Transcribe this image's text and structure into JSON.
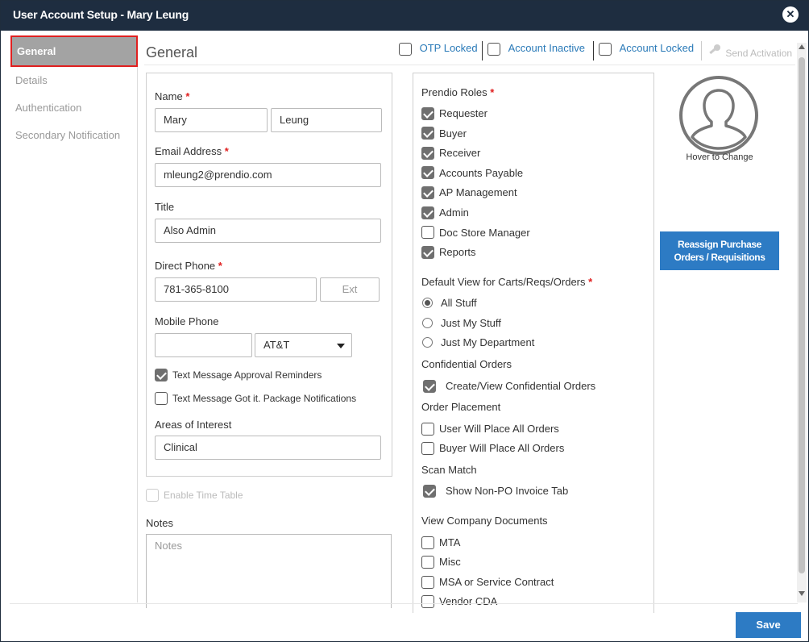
{
  "window": {
    "title": "User Account Setup - Mary Leung"
  },
  "nav": {
    "items": [
      {
        "label": "General"
      },
      {
        "label": "Details"
      },
      {
        "label": "Authentication"
      },
      {
        "label": "Secondary Notification"
      }
    ]
  },
  "header": {
    "title": "General",
    "otp_locked": "OTP Locked",
    "account_inactive": "Account Inactive",
    "account_locked": "Account Locked",
    "send_activation": "Send Activation"
  },
  "form": {
    "name_label": "Name",
    "first_name": "Mary",
    "last_name": "Leung",
    "email_label": "Email Address",
    "email": "mleung2@prendio.com",
    "title_label": "Title",
    "title": "Also Admin",
    "direct_phone_label": "Direct Phone",
    "direct_phone": "781-365-8100",
    "ext_placeholder": "Ext",
    "mobile_phone_label": "Mobile Phone",
    "mobile_phone": "",
    "carrier": "AT&T",
    "text_approval": "Text Message Approval Reminders",
    "text_package": "Text Message Got it. Package Notifications",
    "areas_label": "Areas of Interest",
    "areas": "Clinical",
    "enable_time_table": "Enable Time Table",
    "notes_label": "Notes",
    "notes_placeholder": "Notes",
    "required_mark": "*"
  },
  "roles": {
    "heading": "Prendio Roles",
    "items": [
      {
        "label": "Requester",
        "checked": true
      },
      {
        "label": "Buyer",
        "checked": true
      },
      {
        "label": "Receiver",
        "checked": true
      },
      {
        "label": "Accounts Payable",
        "checked": true
      },
      {
        "label": "AP Management",
        "checked": true
      },
      {
        "label": "Admin",
        "checked": true
      },
      {
        "label": "Doc Store Manager",
        "checked": false
      },
      {
        "label": "Reports",
        "checked": true
      }
    ]
  },
  "default_view": {
    "heading": "Default View for Carts/Reqs/Orders",
    "options": [
      {
        "label": "All Stuff",
        "selected": true
      },
      {
        "label": "Just My Stuff",
        "selected": false
      },
      {
        "label": "Just My Department",
        "selected": false
      }
    ]
  },
  "confidential": {
    "heading": "Confidential Orders",
    "item": "Create/View Confidential Orders"
  },
  "order_placement": {
    "heading": "Order Placement",
    "items": [
      "User Will Place All Orders",
      "Buyer Will Place All Orders"
    ]
  },
  "scan_match": {
    "heading": "Scan Match",
    "item": "Show Non-PO Invoice Tab"
  },
  "company_docs": {
    "heading": "View Company Documents",
    "items": [
      "MTA",
      "Misc",
      "MSA or Service Contract",
      "Vendor CDA"
    ]
  },
  "avatar": {
    "caption": "Hover to Change"
  },
  "reassign": {
    "line1": "Reassign Purchase",
    "line2": "Orders / Requisitions"
  },
  "footer": {
    "save": "Save"
  }
}
